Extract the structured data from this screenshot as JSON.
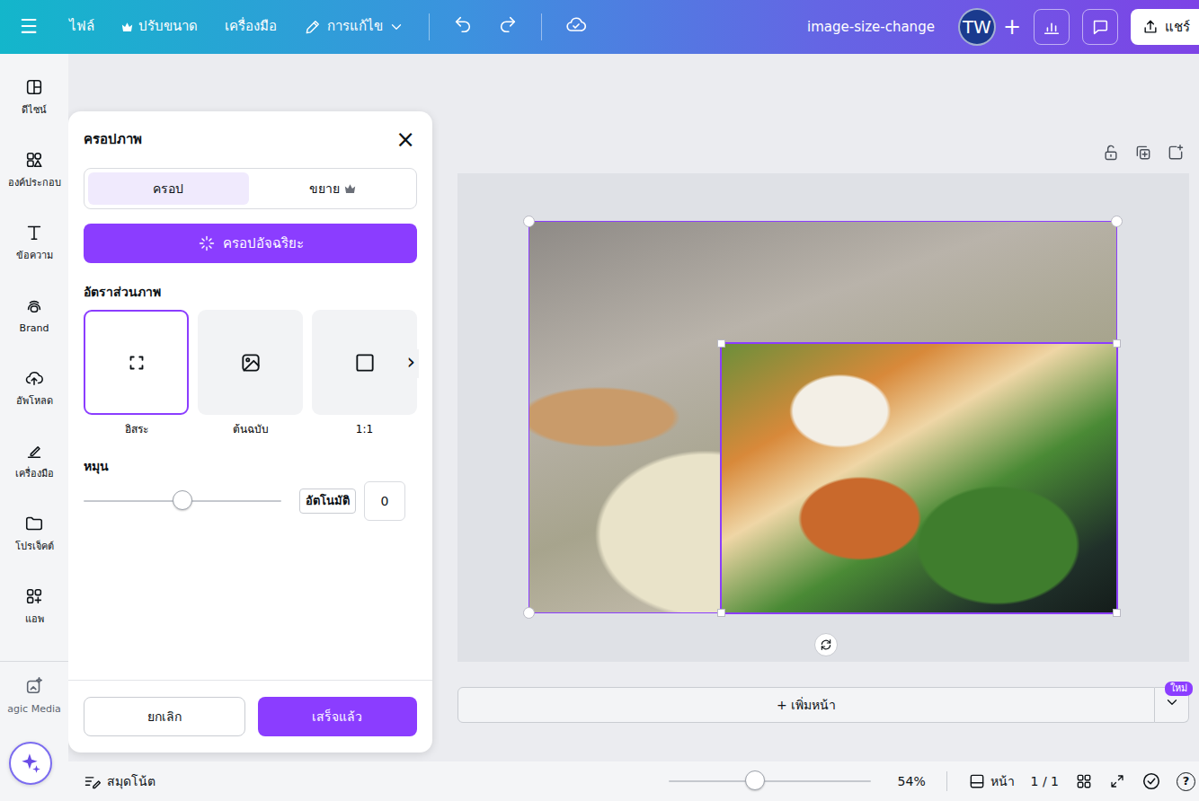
{
  "topbar": {
    "menu_icon": "☰",
    "items": [
      {
        "label": "ไฟล์",
        "premium": false
      },
      {
        "label": "ปรับขนาด",
        "premium": true
      },
      {
        "label": "เครื่องมือ",
        "premium": false
      }
    ],
    "edit_menu": "การแก้ไข",
    "title": "image-size-change",
    "avatar": "TW",
    "add": "+",
    "share": "แชร์"
  },
  "sidebar": {
    "items": [
      {
        "label": "ดีไซน์"
      },
      {
        "label": "องค์ประกอบ"
      },
      {
        "label": "ข้อความ"
      },
      {
        "label": "Brand"
      },
      {
        "label": "อัพโหลด"
      },
      {
        "label": "เครื่องมือ"
      },
      {
        "label": "โปรเจ็คต์"
      },
      {
        "label": "แอพ"
      },
      {
        "label": "agic Media"
      }
    ]
  },
  "crop_panel": {
    "title": "ครอปภาพ",
    "close": "×",
    "tabs": [
      {
        "label": "ครอป",
        "selected": true,
        "premium": false
      },
      {
        "label": "ขยาย",
        "selected": false,
        "premium": true
      }
    ],
    "smart_crop": "ครอปอัจฉริยะ",
    "ratio_heading": "อัตราส่วนภาพ",
    "ratios": [
      {
        "label": "อิสระ",
        "selected": true
      },
      {
        "label": "ต้นฉบับ",
        "selected": false
      },
      {
        "label": "1:1",
        "selected": false
      }
    ],
    "ratio_next": "›",
    "rotate_heading": "หมุน",
    "rotate": {
      "level": 0.5,
      "auto": "อัตโนมัติ",
      "value": "0"
    },
    "cancel": "ยกเลิก",
    "done": "เสร็จแล้ว"
  },
  "canvas": {
    "add_page": "+ เพิ่มหน้า",
    "new_badge": "ใหม่"
  },
  "status_bar": {
    "notes": "สมุดโน้ต",
    "zoom": {
      "level": 0.43,
      "reading": "54%"
    },
    "pages_label": "หน้า",
    "page_count": "1 / 1",
    "help": "?"
  }
}
